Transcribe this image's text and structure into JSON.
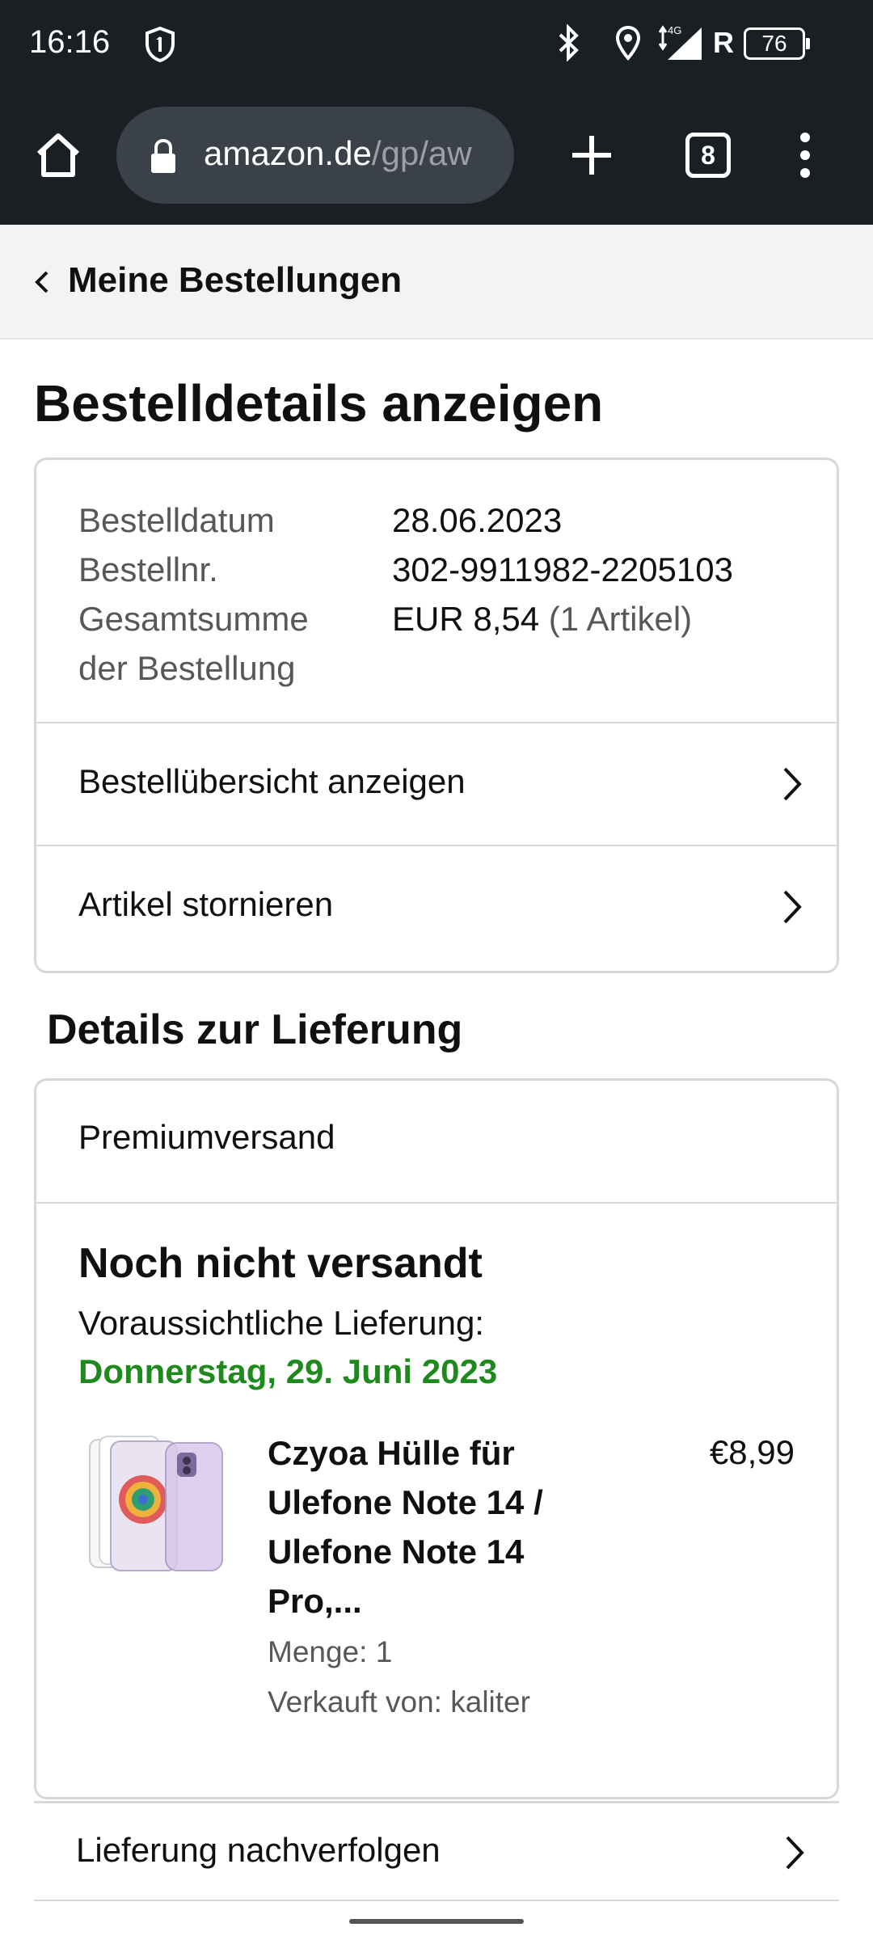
{
  "status_bar": {
    "time": "16:16",
    "network": "4G",
    "roaming": "R",
    "battery": "76",
    "icons": [
      "shield-icon",
      "bluetooth-icon",
      "location-icon",
      "signal-icon",
      "battery-icon"
    ]
  },
  "browser": {
    "url_host": "amazon.de",
    "url_path": "/gp/aw",
    "tab_count": "8",
    "icons": [
      "home-icon",
      "lock-icon",
      "new-tab-icon",
      "tabs-icon",
      "more-vert-icon"
    ]
  },
  "subnav": {
    "back_label": "Meine Bestellungen"
  },
  "page": {
    "title": "Bestelldetails anzeigen"
  },
  "order": {
    "date_label": "Bestelldatum",
    "date_value": "28.06.2023",
    "number_label": "Bestellnr.",
    "number_value": "302-9911982-2205103",
    "total_label_line1": "Gesamtsumme",
    "total_label_line2": "der Bestellung",
    "total_value": "EUR 8,54",
    "total_items": "(1 Artikel)",
    "links": [
      {
        "label": "Bestellübersicht anzeigen"
      },
      {
        "label": "Artikel stornieren"
      }
    ]
  },
  "delivery": {
    "section_title": "Details zur Lieferung",
    "shipping_type": "Premiumversand",
    "status": "Noch nicht versandt",
    "estimate_label": "Voraussichtliche Lieferung:",
    "estimate_date": "Donnerstag, 29. Juni 2023",
    "item": {
      "title": "Czyoa Hülle für Ulefone Note 14 / Ulefone Note 14 Pro,...",
      "price": "€8,99",
      "quantity": "Menge: 1",
      "seller": "Verkauft von: kaliter"
    },
    "track_label": "Lieferung nachverfolgen"
  },
  "colors": {
    "status_bar_bg": "#1a1f24",
    "delivery_date": "#1e8a1e",
    "border": "#d5d9d9",
    "text_secondary": "#565959"
  }
}
